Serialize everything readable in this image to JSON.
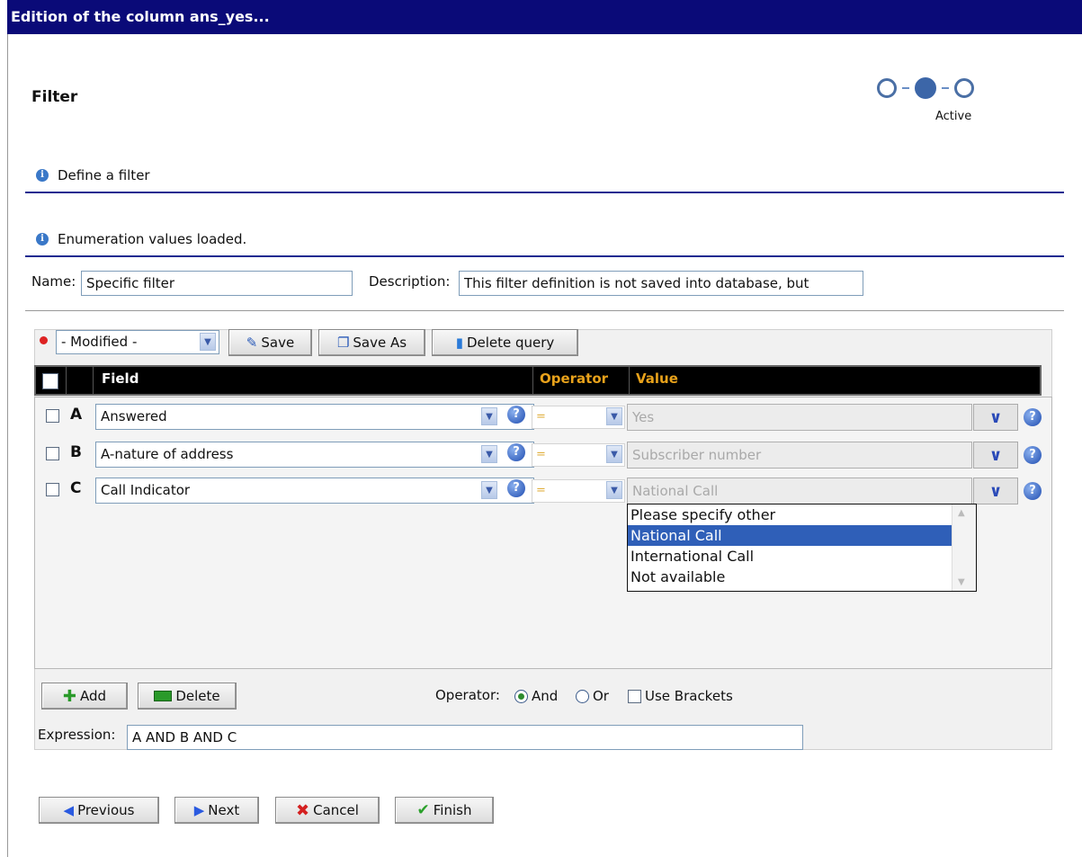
{
  "window": {
    "title": "Edition of the column ans_yes..."
  },
  "header": {
    "title": "Filter",
    "step_label": "Active"
  },
  "info": {
    "define": "Define a filter",
    "loaded": "Enumeration values loaded."
  },
  "form": {
    "name_label": "Name:",
    "name_value": "Specific filter",
    "desc_label": "Description:",
    "desc_value": "This filter definition is not saved into database, but"
  },
  "toolbar": {
    "query_select": "- Modified -",
    "save": "Save",
    "save_as": "Save As",
    "delete_query": "Delete query"
  },
  "table": {
    "headers": {
      "field": "Field",
      "operator": "Operator",
      "value": "Value"
    },
    "rows": [
      {
        "letter": "A",
        "field": "Answered",
        "operator": "=",
        "value": "Yes"
      },
      {
        "letter": "B",
        "field": "A-nature of address",
        "operator": "=",
        "value": "Subscriber number"
      },
      {
        "letter": "C",
        "field": "Call Indicator",
        "operator": "=",
        "value": "National Call"
      }
    ]
  },
  "dropdown": {
    "options": [
      "Please specify other",
      "National Call",
      "International Call",
      "Not available"
    ],
    "selected": "National Call"
  },
  "bottom": {
    "add": "Add",
    "delete": "Delete",
    "operator_label": "Operator:",
    "and": "And",
    "or": "Or",
    "use_brackets": "Use Brackets",
    "expression_label": "Expression:",
    "expression_value": "A AND B AND C"
  },
  "nav": {
    "previous": "Previous",
    "next": "Next",
    "cancel": "Cancel",
    "finish": "Finish"
  },
  "colors": {
    "title_bar": "#0a0a78",
    "accent_line": "#1a2a90",
    "selection": "#2f5fb8",
    "operator_header": "#e8a21b"
  }
}
